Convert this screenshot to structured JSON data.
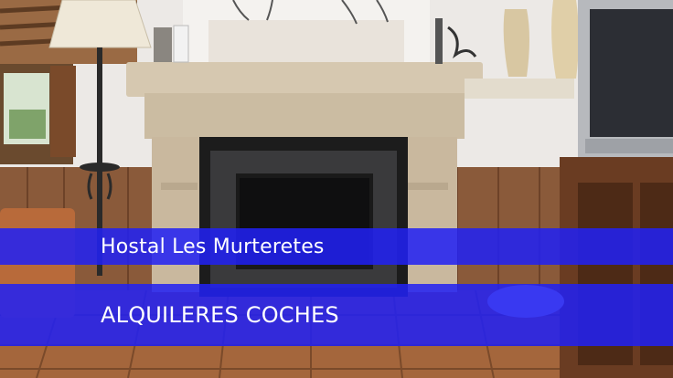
{
  "photo": {
    "subject": "fireplace-room-photo",
    "overlay_color": "#2121f5"
  },
  "captions": {
    "title": "Hostal Les Murteretes",
    "subtitle": "ALQUILERES COCHES"
  }
}
